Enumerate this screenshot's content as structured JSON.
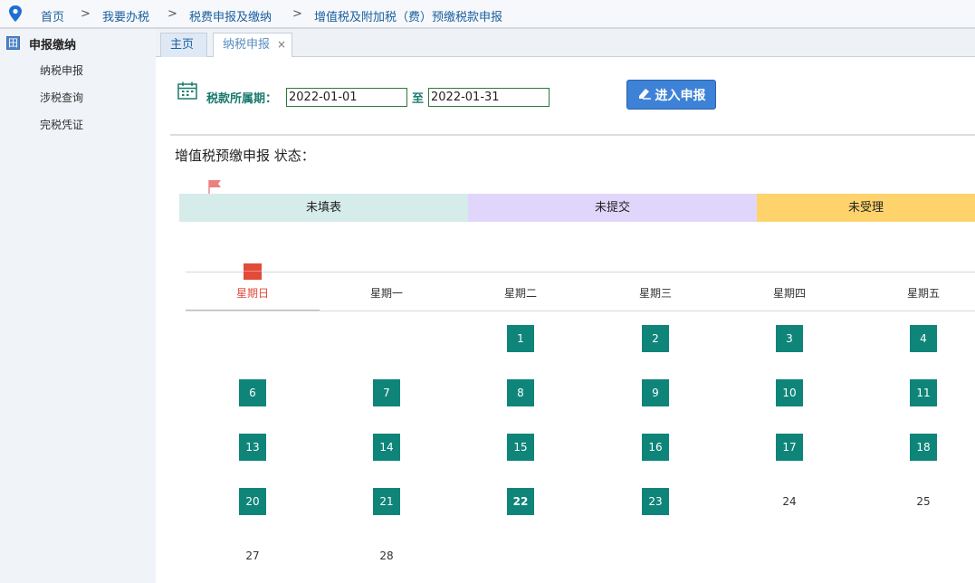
{
  "breadcrumb": {
    "items": [
      "首页",
      "我要办税",
      "税费申报及缴纳",
      "增值税及附加税（费）预缴税款申报"
    ],
    "separator": ">"
  },
  "sidebar": {
    "section_title": "申报缴纳",
    "section_icon": "田",
    "items": [
      "纳税申报",
      "涉税查询",
      "完税凭证"
    ]
  },
  "tabs": {
    "home": "主页",
    "active": "纳税申报",
    "close": "×"
  },
  "period": {
    "label": "税款所属期：",
    "start": "2022-01-01",
    "to": "至",
    "end": "2022-01-31"
  },
  "enter_button": "进入申报",
  "status": {
    "title": "增值税预缴申报 状态：",
    "steps": [
      "未填表",
      "未提交",
      "未受理"
    ],
    "colors": {
      "step1": "#d5ecea",
      "step2": "#e0d6fb",
      "step3": "#fed36b"
    }
  },
  "calendar": {
    "weekdays": [
      "星期日",
      "星期一",
      "星期二",
      "星期三",
      "星期四",
      "星期五"
    ],
    "days": [
      {
        "n": "1",
        "filled": true
      },
      {
        "n": "2",
        "filled": true
      },
      {
        "n": "3",
        "filled": true
      },
      {
        "n": "4",
        "filled": true
      },
      {
        "n": "6",
        "filled": true
      },
      {
        "n": "7",
        "filled": true
      },
      {
        "n": "8",
        "filled": true
      },
      {
        "n": "9",
        "filled": true
      },
      {
        "n": "10",
        "filled": true
      },
      {
        "n": "11",
        "filled": true
      },
      {
        "n": "13",
        "filled": true
      },
      {
        "n": "14",
        "filled": true
      },
      {
        "n": "15",
        "filled": true
      },
      {
        "n": "16",
        "filled": true
      },
      {
        "n": "17",
        "filled": true
      },
      {
        "n": "18",
        "filled": true
      },
      {
        "n": "20",
        "filled": true
      },
      {
        "n": "21",
        "filled": true
      },
      {
        "n": "22",
        "filled": true,
        "bold": true
      },
      {
        "n": "23",
        "filled": true
      },
      {
        "n": "24",
        "filled": false
      },
      {
        "n": "25",
        "filled": false
      },
      {
        "n": "27",
        "filled": false
      },
      {
        "n": "28",
        "filled": false
      }
    ],
    "accent": "#0f857a",
    "weekend_color": "#e14a3a"
  }
}
